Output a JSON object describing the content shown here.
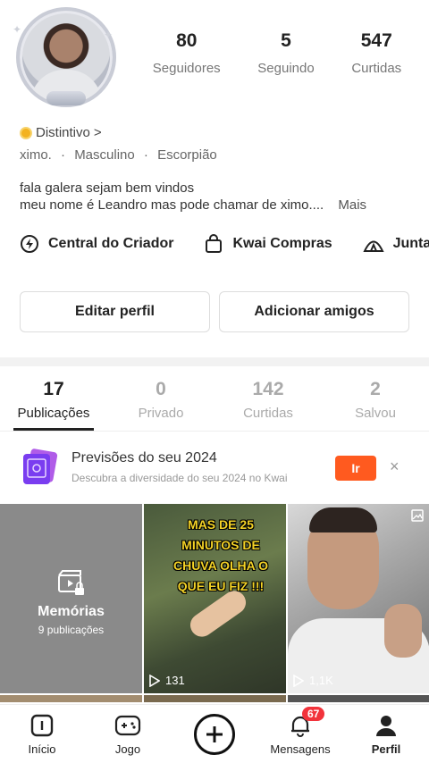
{
  "stats": [
    {
      "value": "80",
      "label": "Seguidores"
    },
    {
      "value": "5",
      "label": "Seguindo"
    },
    {
      "value": "547",
      "label": "Curtidas"
    }
  ],
  "profile": {
    "badge_label": "Distintivo",
    "badge_chevron": ">",
    "username": "ximo.",
    "gender": "Masculino",
    "sign": "Escorpião",
    "separator": "·",
    "bio_line1": "fala galera sejam bem vindos",
    "bio_line2": "meu nome é Leandro mas pode chamar de ximo....",
    "bio_more": "Mais"
  },
  "shortcuts": [
    {
      "label": "Central do Criador",
      "icon": "bolt-circle-icon"
    },
    {
      "label": "Kwai Compras",
      "icon": "shopping-bag-icon"
    },
    {
      "label": "Juntar-",
      "icon": "tent-icon"
    }
  ],
  "actions": {
    "edit_profile": "Editar perfil",
    "add_friends": "Adicionar amigos"
  },
  "tabs": [
    {
      "count": "17",
      "label": "Publicações",
      "active": true
    },
    {
      "count": "0",
      "label": "Privado",
      "active": false
    },
    {
      "count": "142",
      "label": "Curtidas",
      "active": false
    },
    {
      "count": "2",
      "label": "Salvou",
      "active": false
    }
  ],
  "promo": {
    "title": "Previsões do seu 2024",
    "subtitle": "Descubra a diversidade do seu 2024 no Kwai",
    "button": "Ir",
    "close": "×"
  },
  "grid": {
    "memories_title": "Memórias",
    "memories_count": "9 publicações",
    "video1_caption": "MAS DE 25 MINUTOS DE CHUVA OLHA O QUE EU FIZ !!!",
    "video1_views": "131",
    "video2_views": "1,1K"
  },
  "nav": {
    "home": "Início",
    "games": "Jogo",
    "messages": "Mensagens",
    "messages_badge": "67",
    "profile": "Perfil"
  },
  "colors": {
    "accent": "#ff5a1f",
    "badge": "#f2333b",
    "caption_yellow": "#f3d226"
  }
}
